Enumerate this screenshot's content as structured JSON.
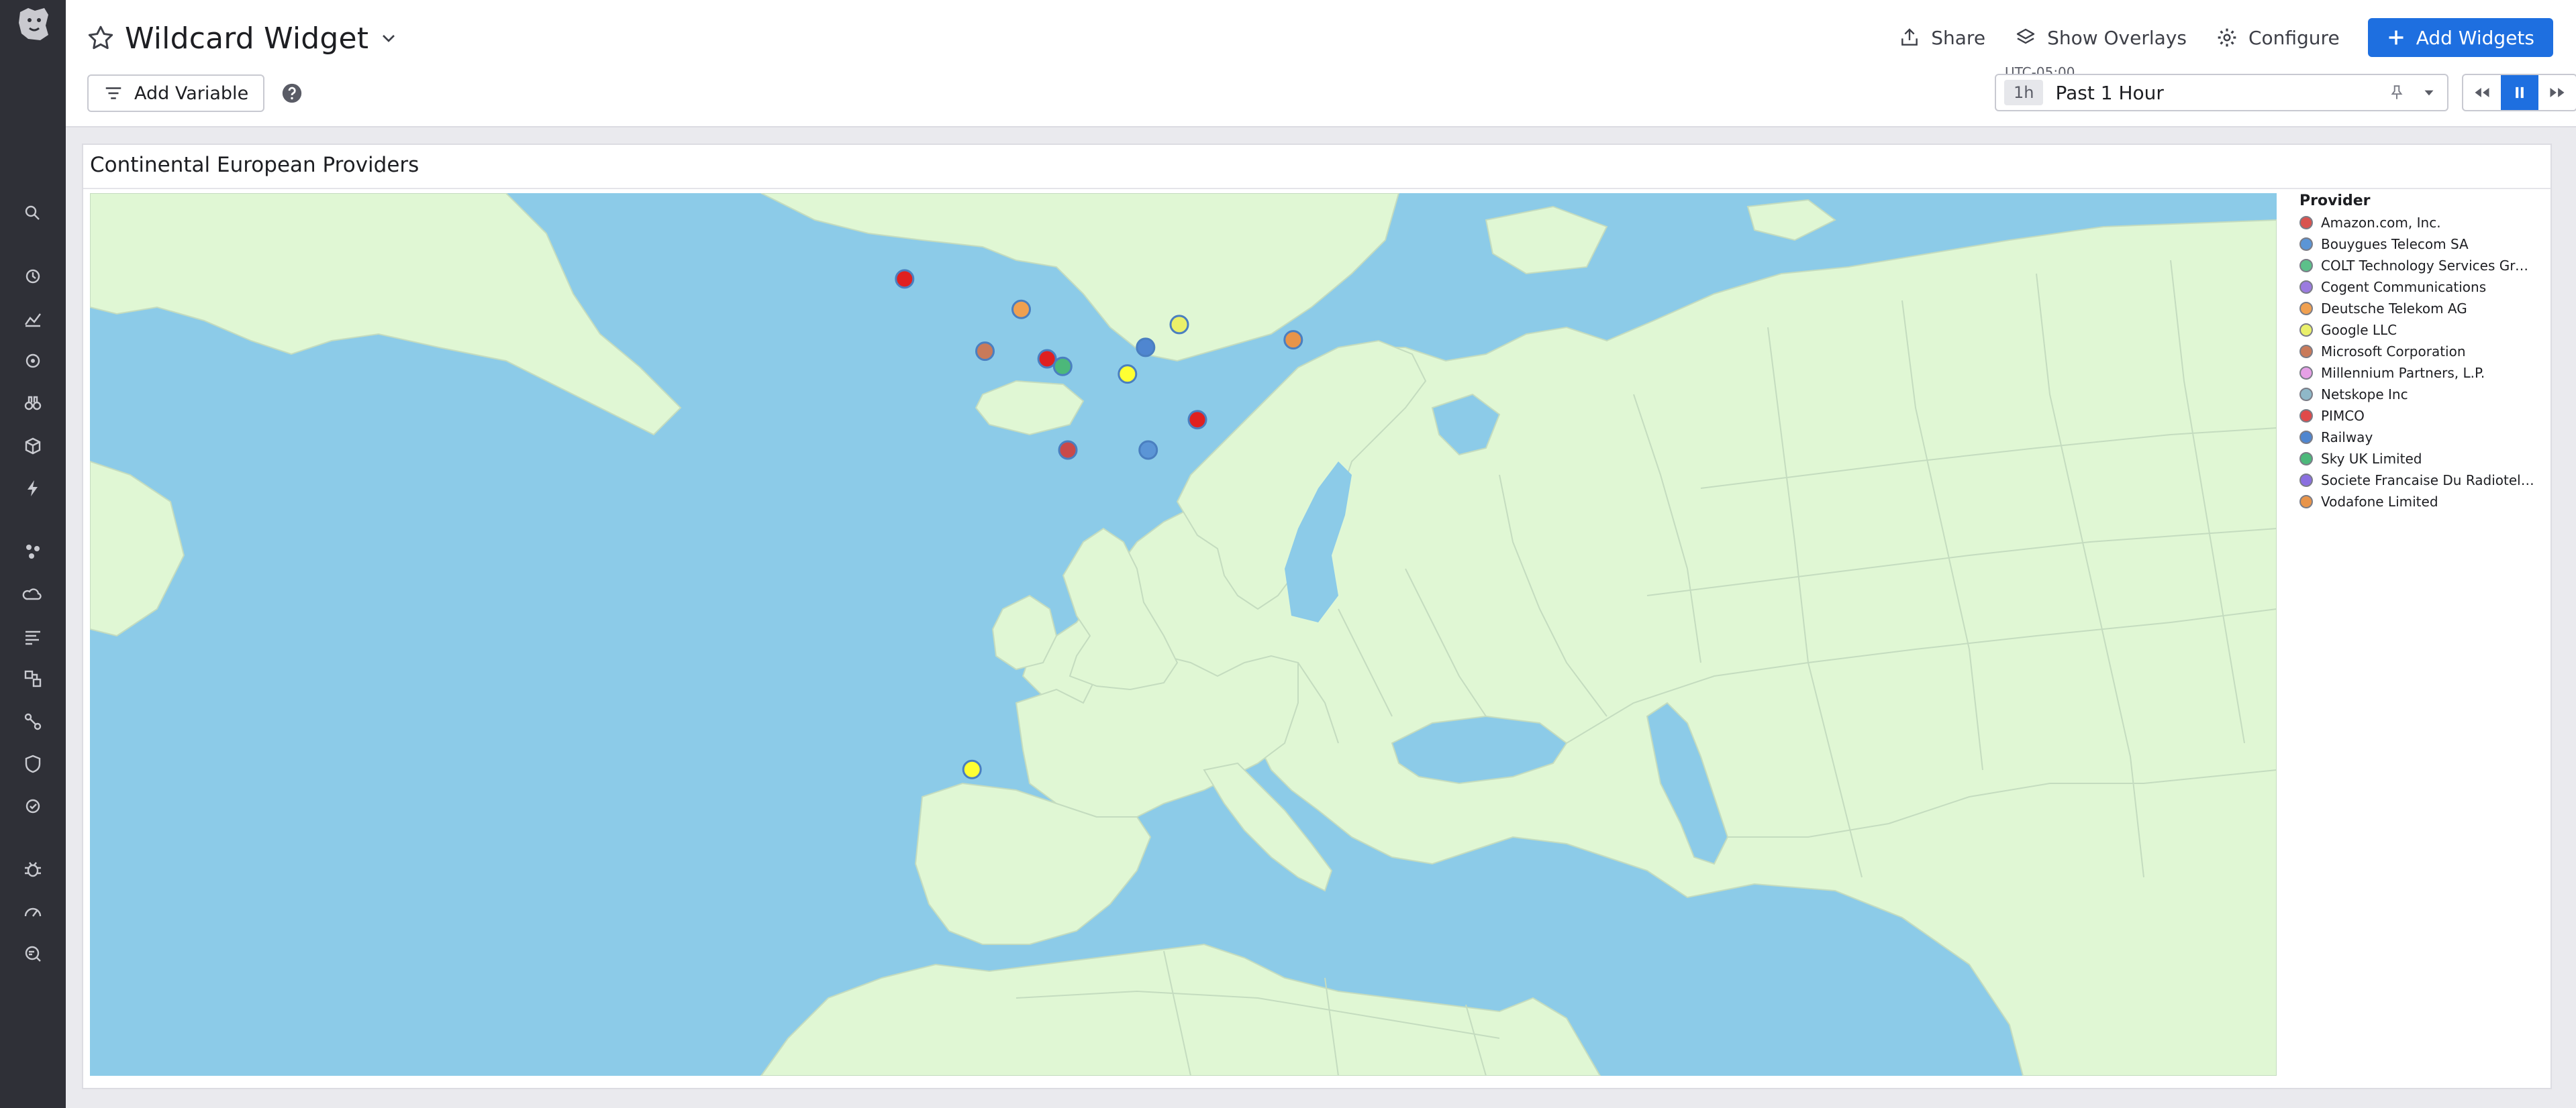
{
  "dashboard": {
    "title": "Wildcard Widget"
  },
  "header": {
    "share_label": "Share",
    "overlays_label": "Show Overlays",
    "configure_label": "Configure",
    "add_widgets_label": "Add Widgets",
    "add_variable_label": "Add Variable"
  },
  "time": {
    "timezone": "UTC-05:00",
    "badge": "1h",
    "label": "Past 1 Hour"
  },
  "nav_icons": [
    "search-icon",
    "history-icon",
    "metrics-icon",
    "monitors-icon",
    "binoculars-icon",
    "integrations-icon",
    "events-icon",
    "infrastructure-icon",
    "cloud-icon",
    "logs-icon",
    "apm-icon",
    "network-icon",
    "security-icon",
    "ci-icon",
    "bug-icon",
    "gauge-icon",
    "synthetics-icon"
  ],
  "widget": {
    "title": "Continental European Providers",
    "legend_title": "Provider",
    "providers": [
      {
        "name": "Amazon.com, Inc.",
        "color": "#d9534f"
      },
      {
        "name": "Bouygues Telecom SA",
        "color": "#5b95d6"
      },
      {
        "name": "COLT Technology Services Grou...",
        "color": "#5cc08a"
      },
      {
        "name": "Cogent Communications",
        "color": "#9b7be0"
      },
      {
        "name": "Deutsche Telekom AG",
        "color": "#f0a050"
      },
      {
        "name": "Google LLC",
        "color": "#eaf06a"
      },
      {
        "name": "Microsoft Corporation",
        "color": "#c97a5a"
      },
      {
        "name": "Millennium Partners, L.P.",
        "color": "#e6a0e6"
      },
      {
        "name": "Netskope Inc",
        "color": "#8fb8c8"
      },
      {
        "name": "PIMCO",
        "color": "#e04a4a"
      },
      {
        "name": "Railway",
        "color": "#4f86d0"
      },
      {
        "name": "Sky UK Limited",
        "color": "#4cb87a"
      },
      {
        "name": "Societe Francaise Du Radiotelep...",
        "color": "#8a6fe0"
      },
      {
        "name": "Vodafone Limited",
        "color": "#e8944a"
      }
    ],
    "points": [
      {
        "lon": -6.3,
        "lat": 53.3,
        "color": "#e02020",
        "provider": "PIMCO"
      },
      {
        "lon": -1.8,
        "lat": 52.5,
        "color": "#f0a050",
        "provider": "Deutsche Telekom AG"
      },
      {
        "lon": -3.2,
        "lat": 51.4,
        "color": "#c97a5a",
        "provider": "Microsoft Corporation"
      },
      {
        "lon": -0.8,
        "lat": 51.2,
        "color": "#e02020",
        "provider": "Amazon.com, Inc."
      },
      {
        "lon": -0.2,
        "lat": 51.0,
        "color": "#4cb87a",
        "provider": "Sky UK Limited"
      },
      {
        "lon": 3.0,
        "lat": 51.5,
        "color": "#4f86d0",
        "provider": "Railway"
      },
      {
        "lon": 4.3,
        "lat": 52.1,
        "color": "#eaf06a",
        "provider": "Google LLC"
      },
      {
        "lon": 2.3,
        "lat": 50.8,
        "color": "#ffff33",
        "provider": "Google LLC"
      },
      {
        "lon": 8.7,
        "lat": 51.7,
        "color": "#e8944a",
        "provider": "Vodafone Limited"
      },
      {
        "lon": 5.0,
        "lat": 49.6,
        "color": "#e02020",
        "provider": "Amazon.com, Inc."
      },
      {
        "lon": 0.0,
        "lat": 48.8,
        "color": "#c94a4a",
        "provider": "Microsoft Corporation"
      },
      {
        "lon": 3.1,
        "lat": 48.8,
        "color": "#5b95d6",
        "provider": "Bouygues Telecom SA"
      },
      {
        "lon": -3.7,
        "lat": 40.4,
        "color": "#ffff33",
        "provider": "Google LLC"
      }
    ]
  }
}
